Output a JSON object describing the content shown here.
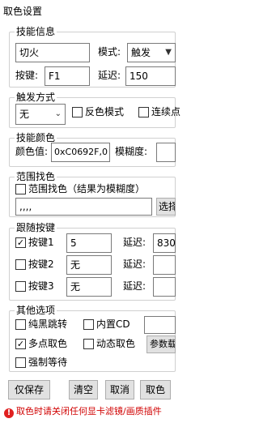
{
  "window": {
    "title": "取色设置"
  },
  "skill_info": {
    "group_title": "技能信息",
    "name_value": "切火",
    "mode_label": "模式:",
    "mode_value": "触发",
    "key_label": "按键:",
    "key_value": "F1",
    "delay_label": "延迟:",
    "delay_value": "150"
  },
  "trigger_mode": {
    "group_title": "触发方式",
    "select_value": "无",
    "invert_color_label": "反色模式",
    "continuous_label": "连续点"
  },
  "skill_color": {
    "group_title": "技能颜色",
    "color_label": "颜色值:",
    "color_value": "0xC0692F,0",
    "fuzz_label": "模糊度:",
    "fuzz_value": ""
  },
  "range_pick": {
    "group_title": "范围找色",
    "checkbox_label": "范围找色（结果为模糊度）",
    "coords_value": ",,,,",
    "select_button": "选择"
  },
  "follow_keys": {
    "group_title": "跟随按键",
    "delay_label": "延迟:",
    "rows": [
      {
        "label": "按键1",
        "key": "5",
        "delay": "830",
        "checked": true
      },
      {
        "label": "按键2",
        "key": "无",
        "delay": "",
        "checked": false
      },
      {
        "label": "按键3",
        "key": "无",
        "delay": "",
        "checked": false
      }
    ]
  },
  "other_options": {
    "group_title": "其他选项",
    "pure_black_label": "纯黑跳转",
    "builtin_cd_label": "内置CD",
    "multi_pick_label": "多点取色",
    "dynamic_pick_label": "动态取色",
    "params_button": "参数载",
    "force_wait_label": "强制等待",
    "multi_pick_checked": true
  },
  "actions": {
    "save_only": "仅保存",
    "clear": "清空",
    "cancel": "取消",
    "pick": "取色"
  },
  "warning": {
    "text": "取色时请关闭任何显卡滤镜/画质插件"
  },
  "icons": {
    "warning": "warning-circle-icon",
    "dropdown": "chevron-down-icon",
    "check": "checkmark-icon"
  },
  "colors": {
    "warning_text": "#d00000",
    "border": "#7a7a7a",
    "button_bg": "#e1e1e1"
  }
}
